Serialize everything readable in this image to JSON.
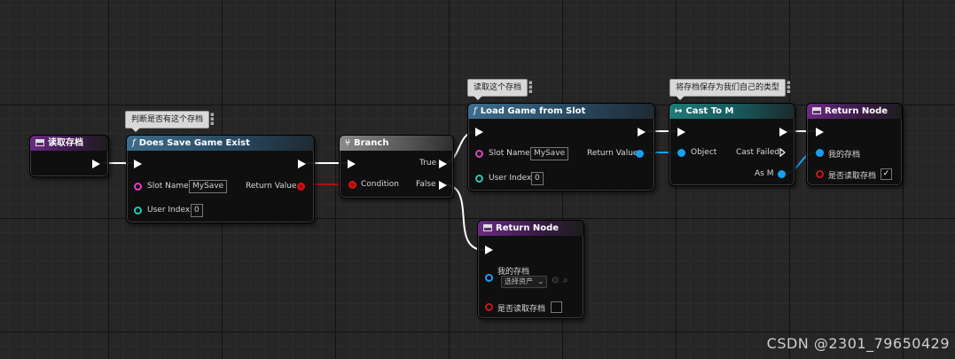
{
  "comments": {
    "does_save_exist": "判断是否有这个存档",
    "load_slot": "读取这个存档",
    "cast": "将存档保存为我们自己的类型"
  },
  "nodes": {
    "read_save": {
      "title": "读取存档"
    },
    "does_save_exist": {
      "title": "Does Save Game Exist",
      "slot_label": "Slot Name",
      "slot_value": "MySave",
      "user_label": "User Index",
      "user_value": "0",
      "return_label": "Return Value"
    },
    "branch": {
      "title": "Branch",
      "condition_label": "Condition",
      "true_label": "True",
      "false_label": "False"
    },
    "load_game": {
      "title": "Load Game from Slot",
      "slot_label": "Slot Name",
      "slot_value": "MySave",
      "user_label": "User Index",
      "user_value": "0",
      "return_label": "Return Value"
    },
    "cast": {
      "title": "Cast To M",
      "object_label": "Object",
      "failed_label": "Cast Failed",
      "as_label": "As M"
    },
    "return_top": {
      "title": "Return Node",
      "my_save_label": "我的存档",
      "is_read_label": "是否读取存档",
      "is_read_checked": "✓"
    },
    "return_bottom": {
      "title": "Return Node",
      "my_save_label": "我的存档",
      "asset_select": "选择资产",
      "is_read_label": "是否读取存档"
    }
  },
  "colors": {
    "exec": "#ffffff",
    "bool": "#c01818",
    "object": "#18a0f0",
    "string": "#e040c0",
    "int": "#2ec4b0"
  },
  "watermark": "CSDN @2301_79650429"
}
